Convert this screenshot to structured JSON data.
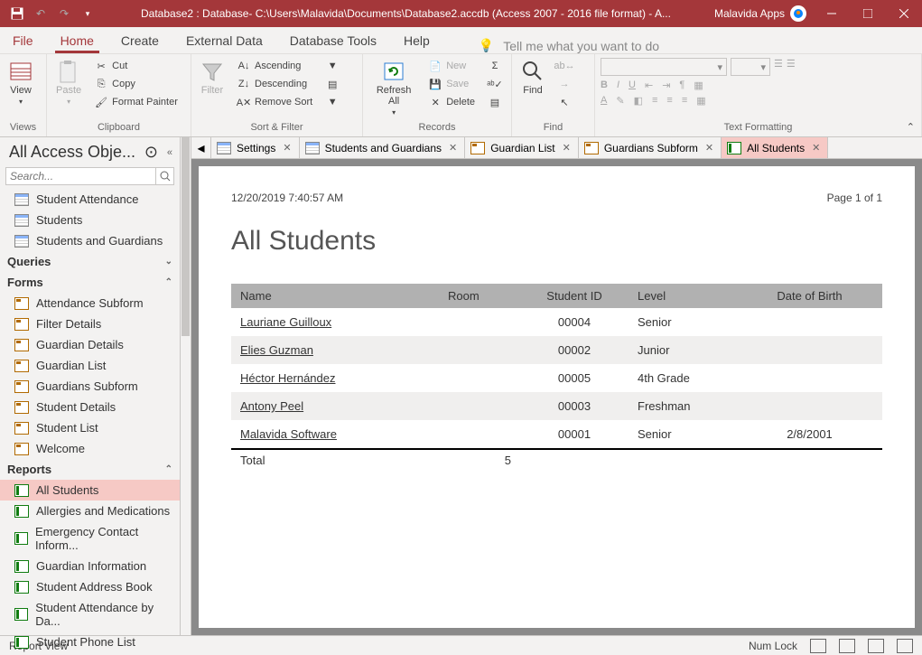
{
  "titlebar": {
    "title": "Database2 : Database- C:\\Users\\Malavida\\Documents\\Database2.accdb (Access 2007 - 2016 file format) -  A...",
    "apps_label": "Malavida Apps"
  },
  "menu": {
    "file": "File",
    "home": "Home",
    "create": "Create",
    "external": "External Data",
    "tools": "Database Tools",
    "help": "Help",
    "tellme": "Tell me what you want to do"
  },
  "ribbon": {
    "views": {
      "label": "Views",
      "view": "View"
    },
    "clipboard": {
      "label": "Clipboard",
      "paste": "Paste",
      "cut": "Cut",
      "copy": "Copy",
      "painter": "Format Painter"
    },
    "sort": {
      "label": "Sort & Filter",
      "filter": "Filter",
      "asc": "Ascending",
      "desc": "Descending",
      "remove": "Remove Sort"
    },
    "records": {
      "label": "Records",
      "refresh": "Refresh All",
      "new": "New",
      "save": "Save",
      "delete": "Delete"
    },
    "find": {
      "label": "Find",
      "find": "Find"
    },
    "textfmt": {
      "label": "Text Formatting"
    }
  },
  "nav": {
    "title": "All Access Obje...",
    "search_ph": "Search...",
    "tables": [
      "Student Attendance",
      "Students",
      "Students and Guardians"
    ],
    "queries_label": "Queries",
    "forms_label": "Forms",
    "forms": [
      "Attendance Subform",
      "Filter Details",
      "Guardian Details",
      "Guardian List",
      "Guardians Subform",
      "Student Details",
      "Student List",
      "Welcome"
    ],
    "reports_label": "Reports",
    "reports": [
      "All Students",
      "Allergies and Medications",
      "Emergency Contact Inform...",
      "Guardian Information",
      "Student Address Book",
      "Student Attendance by Da...",
      "Student Phone List"
    ]
  },
  "doc_tabs": [
    {
      "label": "Settings",
      "type": "table"
    },
    {
      "label": "Students and Guardians",
      "type": "table"
    },
    {
      "label": "Guardian List",
      "type": "form"
    },
    {
      "label": "Guardians Subform",
      "type": "form"
    },
    {
      "label": "All Students",
      "type": "report",
      "active": true
    }
  ],
  "report": {
    "timestamp": "12/20/2019 7:40:57 AM",
    "page": "Page 1 of 1",
    "title": "All Students",
    "columns": [
      "Name",
      "Room",
      "Student ID",
      "Level",
      "Date of Birth"
    ],
    "rows": [
      {
        "name": "Lauriane Guilloux",
        "room": "",
        "sid": "00004",
        "level": "Senior",
        "dob": ""
      },
      {
        "name": "Elies Guzman",
        "room": "",
        "sid": "00002",
        "level": "Junior",
        "dob": ""
      },
      {
        "name": "Héctor Hernández",
        "room": "",
        "sid": "00005",
        "level": "4th Grade",
        "dob": ""
      },
      {
        "name": "Antony Peel",
        "room": "",
        "sid": "00003",
        "level": "Freshman",
        "dob": ""
      },
      {
        "name": "Malavida Software",
        "room": "",
        "sid": "00001",
        "level": "Senior",
        "dob": "2/8/2001"
      }
    ],
    "total_label": "Total",
    "total_value": "5"
  },
  "status": {
    "view": "Report View",
    "numlock": "Num Lock"
  }
}
